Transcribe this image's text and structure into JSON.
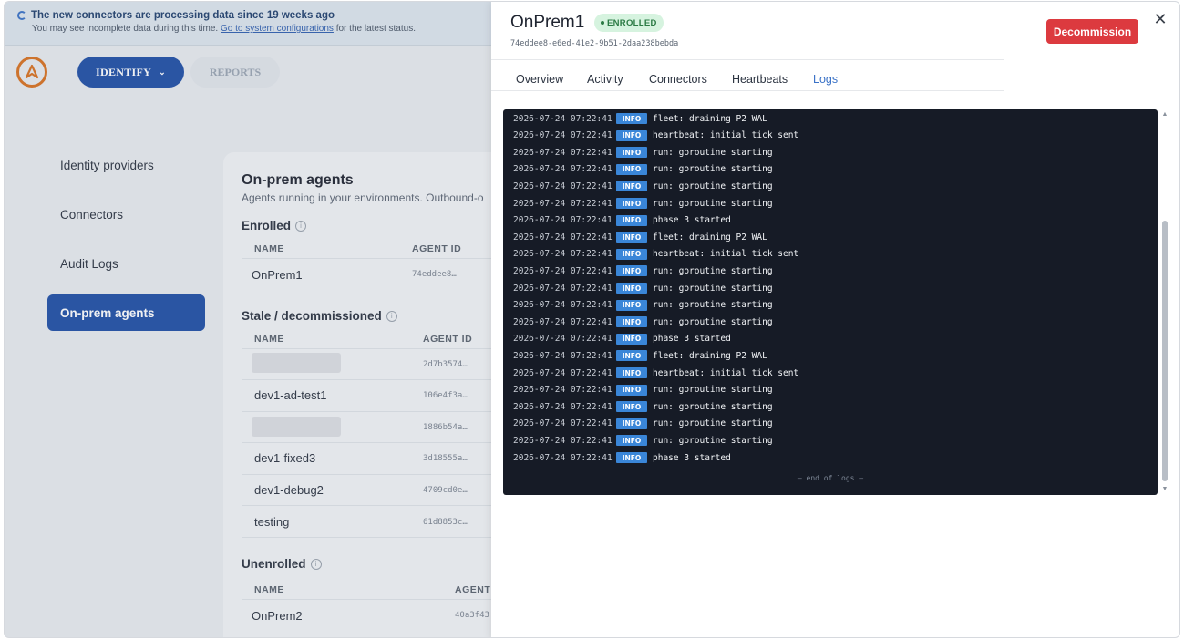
{
  "banner": {
    "title": "The new connectors are processing data since 19 weeks ago",
    "text_before": "You may see incomplete data during this time.",
    "link": "Go to system configurations",
    "text_after": "for the latest status."
  },
  "appbar": {
    "identify_label": "IDENTIFY",
    "reports_label": "REPORTS"
  },
  "sidenav": {
    "items": [
      {
        "label": "Identity providers"
      },
      {
        "label": "Connectors"
      },
      {
        "label": "Audit Logs"
      },
      {
        "label": "On-prem agents"
      }
    ],
    "active_index": 3
  },
  "content": {
    "title": "On-prem agents",
    "subtitle": "Agents running in your environments. Outbound-o",
    "enrolled": {
      "heading": "Enrolled",
      "col_name": "NAME",
      "col_id": "AGENT ID",
      "rows": [
        {
          "name": "OnPrem1",
          "id": "74eddee8…"
        }
      ]
    },
    "stale": {
      "heading": "Stale / decommissioned",
      "col_name": "NAME",
      "col_id": "AGENT ID",
      "rows": [
        {
          "name": "",
          "id": "2d7b3574…"
        },
        {
          "name": "dev1-ad-test1",
          "id": "106e4f3a…"
        },
        {
          "name": "",
          "id": "1886b54a…"
        },
        {
          "name": "dev1-fixed3",
          "id": "3d18555a…"
        },
        {
          "name": "dev1-debug2",
          "id": "4709cd0e…"
        },
        {
          "name": "testing",
          "id": "61d8853c…"
        }
      ]
    },
    "unenrolled": {
      "heading": "Unenrolled",
      "col_name": "NAME",
      "col_id": "AGENT",
      "rows": [
        {
          "name": "OnPrem2",
          "id": "40a3f43"
        }
      ]
    }
  },
  "drawer": {
    "title": "OnPrem1",
    "badge": "ENROLLED",
    "agent_id": "74eddee8-e6ed-41e2-9b51-2daa238bebda",
    "decommission_label": "Decommission",
    "close_glyph": "✕",
    "tabs": [
      "Overview",
      "Activity",
      "Connectors",
      "Heartbeats",
      "Logs"
    ],
    "active_tab": "Logs",
    "logs": [
      {
        "ts": "2026-07-24 07:22:41",
        "level": "INFO",
        "msg": "fleet: draining P2 WAL"
      },
      {
        "ts": "2026-07-24 07:22:41",
        "level": "INFO",
        "msg": "heartbeat: initial tick sent"
      },
      {
        "ts": "2026-07-24 07:22:41",
        "level": "INFO",
        "msg": "run: goroutine starting"
      },
      {
        "ts": "2026-07-24 07:22:41",
        "level": "INFO",
        "msg": "run: goroutine starting"
      },
      {
        "ts": "2026-07-24 07:22:41",
        "level": "INFO",
        "msg": "run: goroutine starting"
      },
      {
        "ts": "2026-07-24 07:22:41",
        "level": "INFO",
        "msg": "run: goroutine starting"
      },
      {
        "ts": "2026-07-24 07:22:41",
        "level": "INFO",
        "msg": "phase 3 started"
      },
      {
        "ts": "2026-07-24 07:22:41",
        "level": "INFO",
        "msg": "fleet: draining P2 WAL"
      },
      {
        "ts": "2026-07-24 07:22:41",
        "level": "INFO",
        "msg": "heartbeat: initial tick sent"
      },
      {
        "ts": "2026-07-24 07:22:41",
        "level": "INFO",
        "msg": "run: goroutine starting"
      },
      {
        "ts": "2026-07-24 07:22:41",
        "level": "INFO",
        "msg": "run: goroutine starting"
      },
      {
        "ts": "2026-07-24 07:22:41",
        "level": "INFO",
        "msg": "run: goroutine starting"
      },
      {
        "ts": "2026-07-24 07:22:41",
        "level": "INFO",
        "msg": "run: goroutine starting"
      },
      {
        "ts": "2026-07-24 07:22:41",
        "level": "INFO",
        "msg": "phase 3 started"
      },
      {
        "ts": "2026-07-24 07:22:41",
        "level": "INFO",
        "msg": "fleet: draining P2 WAL"
      },
      {
        "ts": "2026-07-24 07:22:41",
        "level": "INFO",
        "msg": "heartbeat: initial tick sent"
      },
      {
        "ts": "2026-07-24 07:22:41",
        "level": "INFO",
        "msg": "run: goroutine starting"
      },
      {
        "ts": "2026-07-24 07:22:41",
        "level": "INFO",
        "msg": "run: goroutine starting"
      },
      {
        "ts": "2026-07-24 07:22:41",
        "level": "INFO",
        "msg": "run: goroutine starting"
      },
      {
        "ts": "2026-07-24 07:22:41",
        "level": "INFO",
        "msg": "run: goroutine starting"
      },
      {
        "ts": "2026-07-24 07:22:41",
        "level": "INFO",
        "msg": "phase 3 started"
      }
    ],
    "end_of_logs": "— end of logs —"
  },
  "colors": {
    "primary": "#1f4fa6",
    "danger": "#dc3a3f",
    "log_bg": "#161b26",
    "info_badge": "#3a86d8",
    "enrolled_badge_bg": "#d6f3df",
    "logo_orange": "#d9711f"
  }
}
